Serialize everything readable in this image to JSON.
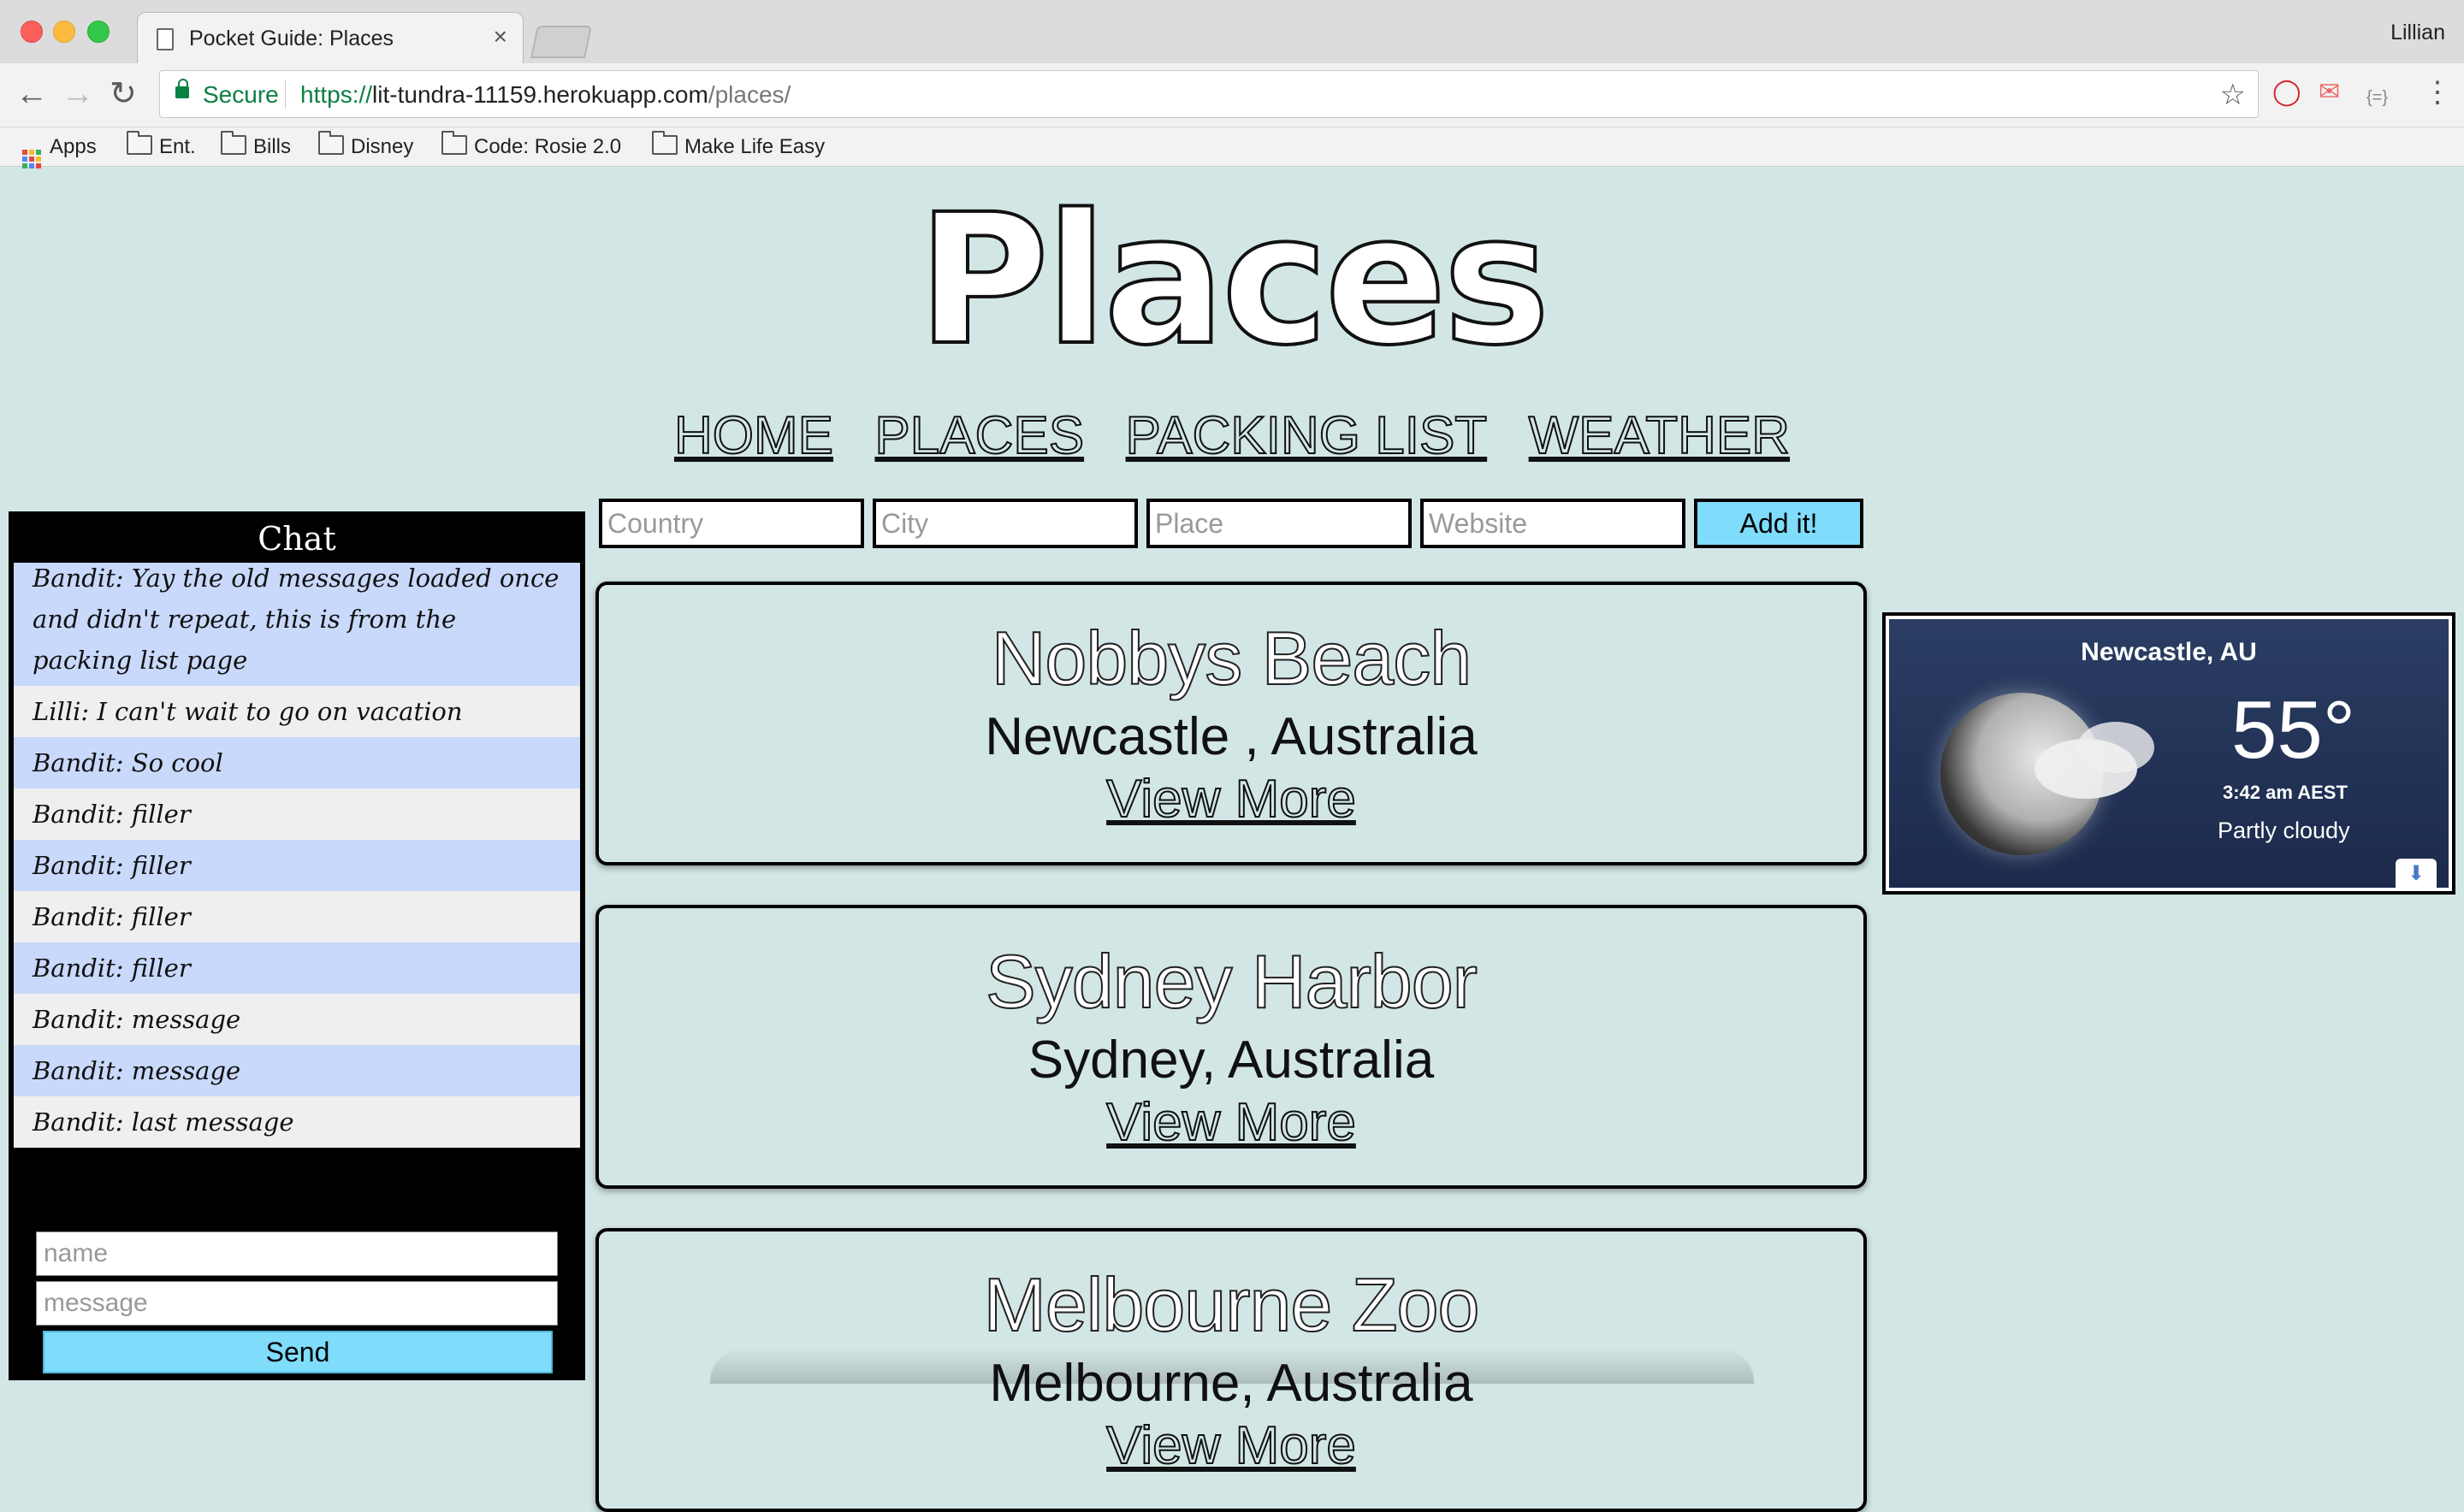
{
  "browser": {
    "tab_title": "Pocket Guide: Places",
    "tab_close": "×",
    "profile": "Lillian",
    "secure_label": "Secure",
    "url_scheme": "https://",
    "url_host": "lit-tundra-11159.herokuapp.com",
    "url_path": "/places/",
    "bookmarks": [
      "Apps",
      "Ent.",
      "Bills",
      "Disney",
      "Code: Rosie 2.0",
      "Make Life Easy"
    ]
  },
  "page": {
    "title": "Places",
    "nav": [
      "HOME",
      "PLACES",
      "PACKING LIST",
      "WEATHER"
    ]
  },
  "add_form": {
    "country_placeholder": "Country",
    "city_placeholder": "City",
    "place_placeholder": "Place",
    "website_placeholder": "Website",
    "submit_label": "Add it!"
  },
  "chat": {
    "header": "Chat",
    "messages": [
      "Bandit: Yay the old messages loaded once and didn't repeat, this is from the packing list page",
      "Lilli: I can't wait to go on vacation",
      "Bandit: So cool",
      "Bandit: filler",
      "Bandit: filler",
      "Bandit: filler",
      "Bandit: filler",
      "Bandit: message",
      "Bandit: message",
      "Bandit: last message"
    ],
    "name_placeholder": "name",
    "message_placeholder": "message",
    "send_label": "Send"
  },
  "places": [
    {
      "name": "Nobbys Beach",
      "location": "Newcastle , Australia",
      "link": "View More"
    },
    {
      "name": "Sydney Harbor",
      "location": "Sydney, Australia",
      "link": "View More"
    },
    {
      "name": "Melbourne Zoo",
      "location": "Melbourne, Australia",
      "link": "View More"
    }
  ],
  "weather": {
    "city": "Newcastle, AU",
    "temp": "55°",
    "time": "3:42 am AEST",
    "condition": "Partly cloudy"
  },
  "colors": {
    "page_bg": "#d3e6e6",
    "button_blue": "#7fdcfb",
    "chat_odd_row": "#c9d9fb",
    "chat_even_row": "#efefef"
  }
}
